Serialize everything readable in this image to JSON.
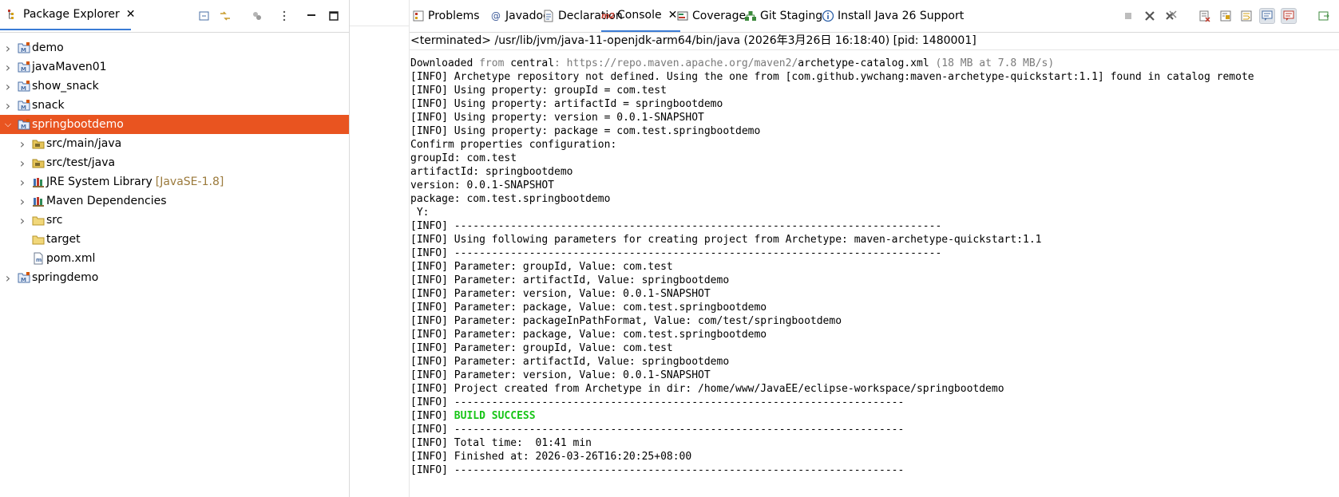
{
  "package_explorer": {
    "tab_title": "Package Explorer",
    "toolbar_icons": [
      "collapse-all-icon",
      "link-with-editor-icon",
      "filters-icon",
      "view-menu-icon",
      "minimize-icon",
      "maximize-icon"
    ],
    "items": [
      {
        "label": "demo",
        "level": 0,
        "expandable": true,
        "expanded": false,
        "icon": "maven-project-icon"
      },
      {
        "label": "javaMaven01",
        "level": 0,
        "expandable": true,
        "expanded": false,
        "icon": "maven-project-icon"
      },
      {
        "label": "show_snack",
        "level": 0,
        "expandable": true,
        "expanded": false,
        "icon": "maven-project-icon"
      },
      {
        "label": "snack",
        "level": 0,
        "expandable": true,
        "expanded": false,
        "icon": "maven-project-icon"
      },
      {
        "label": "springbootdemo",
        "level": 0,
        "expandable": true,
        "expanded": true,
        "selected": true,
        "icon": "maven-project-icon"
      },
      {
        "label": "src/main/java",
        "level": 1,
        "expandable": true,
        "expanded": false,
        "icon": "source-folder-icon"
      },
      {
        "label": "src/test/java",
        "level": 1,
        "expandable": true,
        "expanded": false,
        "icon": "source-folder-icon"
      },
      {
        "label": "JRE System Library",
        "decoration": "[JavaSE-1.8]",
        "level": 1,
        "expandable": true,
        "expanded": false,
        "icon": "library-icon"
      },
      {
        "label": "Maven Dependencies",
        "level": 1,
        "expandable": true,
        "expanded": false,
        "icon": "library-icon"
      },
      {
        "label": "src",
        "level": 1,
        "expandable": true,
        "expanded": false,
        "icon": "folder-icon"
      },
      {
        "label": "target",
        "level": 1,
        "expandable": false,
        "icon": "folder-icon"
      },
      {
        "label": "pom.xml",
        "level": 1,
        "expandable": false,
        "icon": "maven-file-icon"
      },
      {
        "label": "springdemo",
        "level": 0,
        "expandable": true,
        "expanded": false,
        "icon": "maven-project-icon"
      }
    ]
  },
  "views": {
    "tabs": [
      {
        "label": "Problems",
        "icon": "problems-icon"
      },
      {
        "label": "Javadoc",
        "icon": "javadoc-icon"
      },
      {
        "label": "Declaration",
        "icon": "declaration-icon"
      },
      {
        "label": "Console",
        "icon": "maven-console-icon",
        "active": true
      },
      {
        "label": "Coverage",
        "icon": "coverage-icon"
      },
      {
        "label": "Git Staging",
        "icon": "git-staging-icon"
      },
      {
        "label": "Install Java 26 Support",
        "icon": "info-icon"
      }
    ],
    "console_icon_text": "m2",
    "toolbar_icons": [
      "terminate-icon",
      "remove-launch-icon",
      "remove-all-icon",
      "clear-console-icon",
      "scroll-lock-icon",
      "word-wrap-icon",
      "show-on-stdout-icon",
      "show-on-stderr-icon",
      "open-console-icon"
    ]
  },
  "console": {
    "terminated_line": "<terminated> /usr/lib/jvm/java-11-openjdk-arm64/bin/java (2026年3月26日 16:18:40) [pid: 1480001]",
    "lines": [
      [
        {
          "t": "Downloaded "
        },
        {
          "t": "from",
          "c": "grey"
        },
        {
          "t": " central"
        },
        {
          "t": ": https://repo.maven.apache.org/maven2/",
          "c": "grey"
        },
        {
          "t": "archetype-catalog.xml"
        },
        {
          "t": " (18 MB at 7.8 MB/s)",
          "c": "grey"
        }
      ],
      [
        {
          "t": "[INFO] Archetype repository not defined. Using the one from [com.github.ywchang:maven-archetype-quickstart:1.1] found in catalog remote"
        }
      ],
      [
        {
          "t": "[INFO] Using property: groupId = com.test"
        }
      ],
      [
        {
          "t": "[INFO] Using property: artifactId = springbootdemo"
        }
      ],
      [
        {
          "t": "[INFO] Using property: version = 0.0.1-SNAPSHOT"
        }
      ],
      [
        {
          "t": "[INFO] Using property: package = com.test.springbootdemo"
        }
      ],
      [
        {
          "t": "Confirm properties configuration:"
        }
      ],
      [
        {
          "t": "groupId: com.test"
        }
      ],
      [
        {
          "t": "artifactId: springbootdemo"
        }
      ],
      [
        {
          "t": "version: 0.0.1-SNAPSHOT"
        }
      ],
      [
        {
          "t": "package: com.test.springbootdemo"
        }
      ],
      [
        {
          "t": " Y:"
        }
      ],
      [
        {
          "t": "[INFO] ------------------------------------------------------------------------------"
        }
      ],
      [
        {
          "t": "[INFO] Using following parameters for creating project from Archetype: maven-archetype-quickstart:1.1"
        }
      ],
      [
        {
          "t": "[INFO] ------------------------------------------------------------------------------"
        }
      ],
      [
        {
          "t": "[INFO] Parameter: groupId, Value: com.test"
        }
      ],
      [
        {
          "t": "[INFO] Parameter: artifactId, Value: springbootdemo"
        }
      ],
      [
        {
          "t": "[INFO] Parameter: version, Value: 0.0.1-SNAPSHOT"
        }
      ],
      [
        {
          "t": "[INFO] Parameter: package, Value: com.test.springbootdemo"
        }
      ],
      [
        {
          "t": "[INFO] Parameter: packageInPathFormat, Value: com/test/springbootdemo"
        }
      ],
      [
        {
          "t": "[INFO] Parameter: package, Value: com.test.springbootdemo"
        }
      ],
      [
        {
          "t": "[INFO] Parameter: groupId, Value: com.test"
        }
      ],
      [
        {
          "t": "[INFO] Parameter: artifactId, Value: springbootdemo"
        }
      ],
      [
        {
          "t": "[INFO] Parameter: version, Value: 0.0.1-SNAPSHOT"
        }
      ],
      [
        {
          "t": "[INFO] Project created from Archetype in dir: /home/www/JavaEE/eclipse-workspace/springbootdemo"
        }
      ],
      [
        {
          "t": "[INFO] ------------------------------------------------------------------------"
        }
      ],
      [
        {
          "t": "[INFO] "
        },
        {
          "t": "BUILD SUCCESS",
          "c": "ok"
        }
      ],
      [
        {
          "t": "[INFO] ------------------------------------------------------------------------"
        }
      ],
      [
        {
          "t": "[INFO] Total time:  01:41 min"
        }
      ],
      [
        {
          "t": "[INFO] Finished at: 2026-03-26T16:20:25+08:00"
        }
      ],
      [
        {
          "t": "[INFO] ------------------------------------------------------------------------"
        }
      ]
    ]
  },
  "colors": {
    "selection": "#e95420",
    "active_tab_underline": "#3a7bd5",
    "build_success": "#17c517",
    "url_grey": "#7a7a7a"
  }
}
